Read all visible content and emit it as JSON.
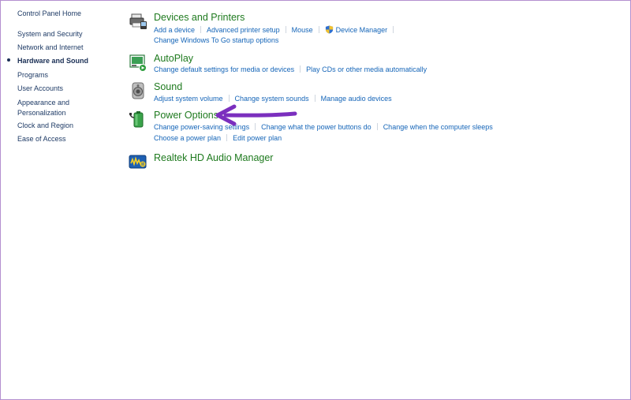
{
  "leftnav": {
    "home": "Control Panel Home",
    "items": [
      {
        "label": "System and Security"
      },
      {
        "label": "Network and Internet"
      },
      {
        "label": "Hardware and Sound"
      },
      {
        "label": "Programs"
      },
      {
        "label": "User Accounts"
      },
      {
        "label": "Appearance and"
      },
      {
        "label": "Personalization"
      },
      {
        "label": "Clock and Region"
      },
      {
        "label": "Ease of Access"
      }
    ]
  },
  "categories": {
    "devices": {
      "title": "Devices and Printers",
      "icon": "printer-icon",
      "links": [
        "Add a device",
        "Advanced printer setup",
        "Mouse",
        "Device Manager",
        "Change Windows To Go startup options"
      ]
    },
    "autoplay": {
      "title": "AutoPlay",
      "icon": "autoplay-icon",
      "links": [
        "Change default settings for media or devices",
        "Play CDs or other media automatically"
      ]
    },
    "sound": {
      "title": "Sound",
      "icon": "speaker-icon",
      "links": [
        "Adjust system volume",
        "Change system sounds",
        "Manage audio devices"
      ]
    },
    "power": {
      "title": "Power Options",
      "icon": "battery-icon",
      "links": [
        "Change power-saving settings",
        "Change what the power buttons do",
        "Change when the computer sleeps",
        "Choose a power plan",
        "Edit power plan"
      ]
    },
    "realtek": {
      "title": "Realtek HD Audio Manager",
      "icon": "realtek-audio-icon"
    }
  },
  "colors": {
    "title_green": "#1e7a1e",
    "link_blue": "#1565b8",
    "arrow_purple": "#7b2fbe"
  }
}
